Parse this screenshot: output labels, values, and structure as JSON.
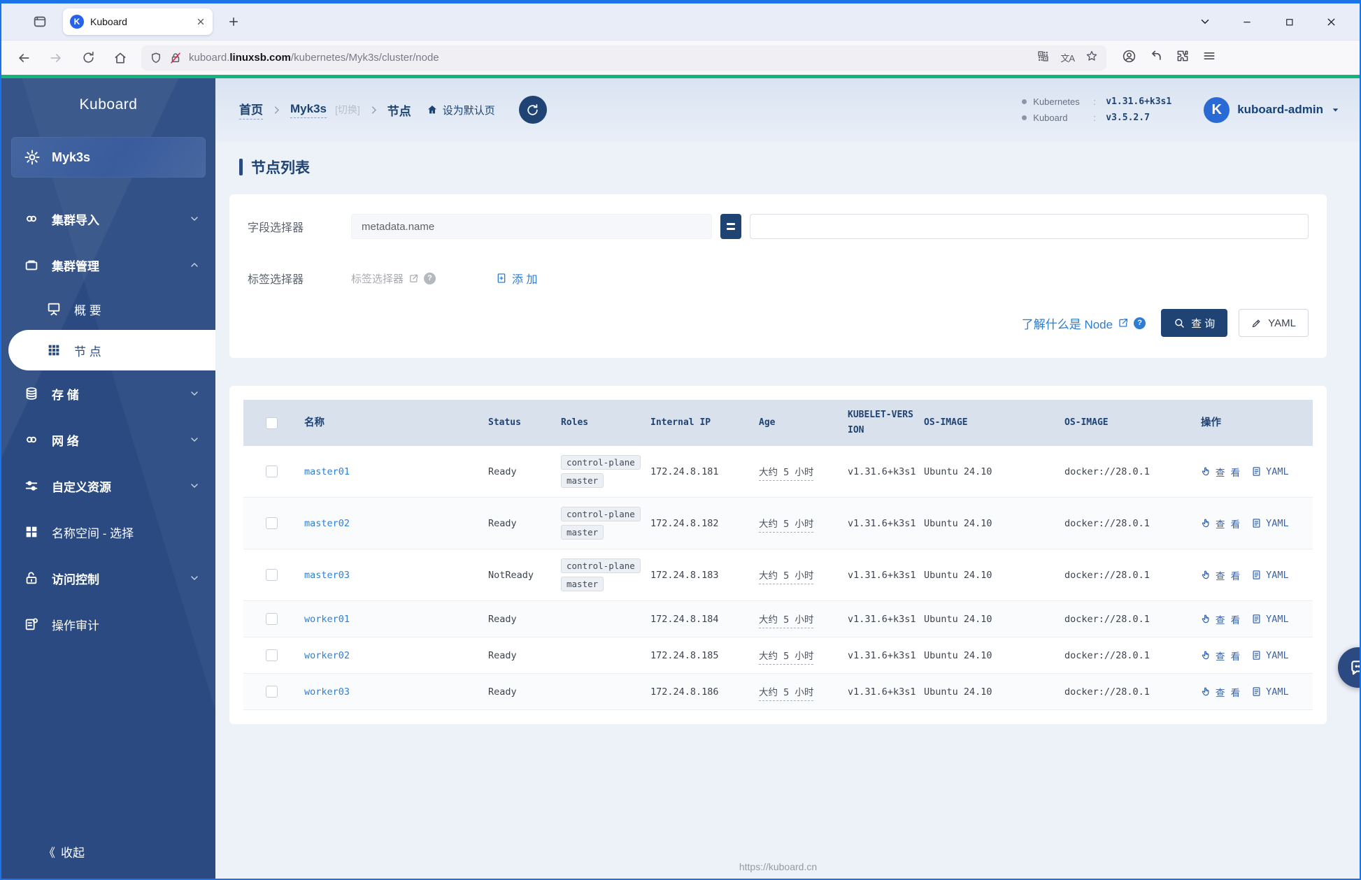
{
  "browser": {
    "tab_title": "Kuboard",
    "favicon_letter": "K",
    "url_subdomain": "kuboard.",
    "url_domain": "linuxsb.com",
    "url_path": "/kubernetes/Myk3s/cluster/node",
    "translate_glyph": "文A"
  },
  "sidebar": {
    "brand": "Kuboard",
    "cluster_label": "Myk3s",
    "items": [
      {
        "label": "集群导入",
        "icon": "cluster-import",
        "bold": true,
        "chevron": "down",
        "indent": false,
        "active": false
      },
      {
        "label": "集群管理",
        "icon": "cluster-manage",
        "bold": true,
        "chevron": "up",
        "indent": false,
        "active": false
      },
      {
        "label": "概 要",
        "icon": "overview",
        "bold": false,
        "chevron": null,
        "indent": true,
        "active": false
      },
      {
        "label": "节 点",
        "icon": "nodes",
        "bold": false,
        "chevron": null,
        "indent": true,
        "active": true
      },
      {
        "label": "存 储",
        "icon": "storage",
        "bold": true,
        "chevron": "down",
        "indent": false,
        "active": false
      },
      {
        "label": "网 络",
        "icon": "network",
        "bold": true,
        "chevron": "down",
        "indent": false,
        "active": false
      },
      {
        "label": "自定义资源",
        "icon": "custom-resource",
        "bold": true,
        "chevron": "down",
        "indent": false,
        "active": false
      },
      {
        "label": "名称空间 - 选择",
        "icon": "namespace",
        "bold": false,
        "chevron": null,
        "indent": false,
        "active": false
      },
      {
        "label": "访问控制",
        "icon": "access-control",
        "bold": true,
        "chevron": "down",
        "indent": false,
        "active": false
      },
      {
        "label": "操作审计",
        "icon": "audit",
        "bold": false,
        "chevron": null,
        "indent": false,
        "active": false
      }
    ],
    "collapse_arrows": "《",
    "collapse_label": "收起"
  },
  "header": {
    "breadcrumb": {
      "home": "首页",
      "cluster": "Myk3s",
      "switch_hint": "[切换]",
      "page": "节点",
      "set_default": "设为默认页"
    },
    "versions": [
      {
        "label": "Kubernetes",
        "colon": ":",
        "value": "v1.31.6+k3s1"
      },
      {
        "label": "Kuboard",
        "colon": ":",
        "value": "v3.5.2.7"
      }
    ],
    "user": {
      "name": "kuboard-admin",
      "avatar_letter": "K"
    }
  },
  "page": {
    "title": "节点列表",
    "filter": {
      "field_selector_label": "字段选择器",
      "field_selector_value": "metadata.name",
      "field_value_input": "",
      "label_selector_label": "标签选择器",
      "label_selector_link": "标签选择器",
      "add_label": "添 加",
      "learn_link": "了解什么是 Node",
      "search_button": "查 询",
      "yaml_button": "YAML"
    },
    "table": {
      "columns": [
        "名称",
        "Status",
        "Roles",
        "Internal IP",
        "Age",
        "KUBELET-VERSION",
        "OS-IMAGE",
        "OS-IMAGE",
        "操作"
      ],
      "actions": {
        "view": "查 看",
        "yaml": "YAML"
      },
      "rows": [
        {
          "name": "master01",
          "status": "Ready",
          "roles": [
            "control-plane",
            "master"
          ],
          "internal_ip": "172.24.8.181",
          "age": "大约 5 小时",
          "kubelet_version": "v1.31.6+k3s1",
          "os_image": "Ubuntu 24.10",
          "container_runtime": "docker://28.0.1"
        },
        {
          "name": "master02",
          "status": "Ready",
          "roles": [
            "control-plane",
            "master"
          ],
          "internal_ip": "172.24.8.182",
          "age": "大约 5 小时",
          "kubelet_version": "v1.31.6+k3s1",
          "os_image": "Ubuntu 24.10",
          "container_runtime": "docker://28.0.1"
        },
        {
          "name": "master03",
          "status": "NotReady",
          "roles": [
            "control-plane",
            "master"
          ],
          "internal_ip": "172.24.8.183",
          "age": "大约 5 小时",
          "kubelet_version": "v1.31.6+k3s1",
          "os_image": "Ubuntu 24.10",
          "container_runtime": "docker://28.0.1"
        },
        {
          "name": "worker01",
          "status": "Ready",
          "roles": [],
          "internal_ip": "172.24.8.184",
          "age": "大约 5 小时",
          "kubelet_version": "v1.31.6+k3s1",
          "os_image": "Ubuntu 24.10",
          "container_runtime": "docker://28.0.1"
        },
        {
          "name": "worker02",
          "status": "Ready",
          "roles": [],
          "internal_ip": "172.24.8.185",
          "age": "大约 5 小时",
          "kubelet_version": "v1.31.6+k3s1",
          "os_image": "Ubuntu 24.10",
          "container_runtime": "docker://28.0.1"
        },
        {
          "name": "worker03",
          "status": "Ready",
          "roles": [],
          "internal_ip": "172.24.8.186",
          "age": "大约 5 小时",
          "kubelet_version": "v1.31.6+k3s1",
          "os_image": "Ubuntu 24.10",
          "container_runtime": "docker://28.0.1"
        }
      ]
    },
    "footer": "https://kuboard.cn"
  }
}
